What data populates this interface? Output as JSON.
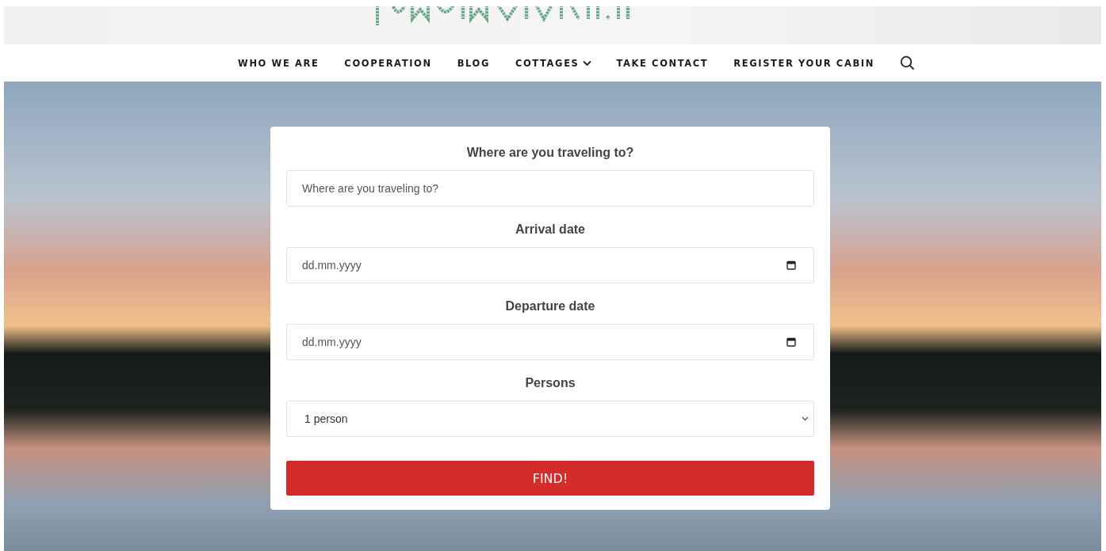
{
  "nav": {
    "items": [
      {
        "label": "WHO WE ARE",
        "kind": "link"
      },
      {
        "label": "COOPERATION",
        "kind": "link"
      },
      {
        "label": "BLOG",
        "kind": "link"
      },
      {
        "label": "COTTAGES",
        "kind": "dropdown"
      },
      {
        "label": "TAKE CONTACT",
        "kind": "link"
      },
      {
        "label": "REGISTER YOUR CABIN",
        "kind": "link"
      }
    ]
  },
  "search_form": {
    "fields": [
      {
        "label": "Where are you traveling to?",
        "kind": "text",
        "placeholder": "Where are you traveling to?"
      },
      {
        "label": "Arrival date",
        "kind": "date",
        "placeholder": "dd.mm.yyyy"
      },
      {
        "label": "Departure date",
        "kind": "date",
        "placeholder": "dd.mm.yyyy"
      },
      {
        "label": "Persons",
        "kind": "select",
        "value": "1 person"
      }
    ],
    "button": "FIND!"
  }
}
